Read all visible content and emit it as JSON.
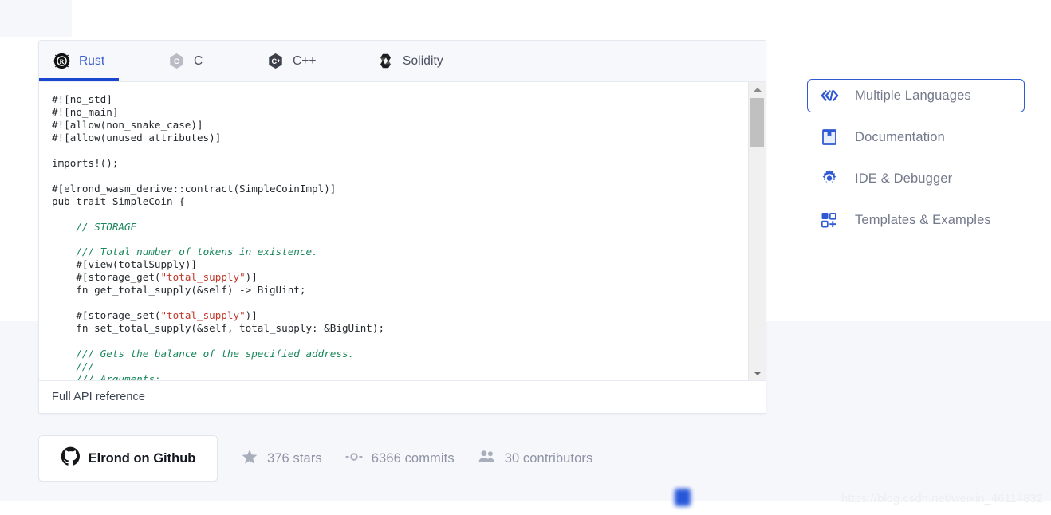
{
  "tabs": [
    {
      "label": "Rust",
      "icon": "rust-logo-icon",
      "active": true
    },
    {
      "label": "C",
      "icon": "c-logo-icon",
      "active": false
    },
    {
      "label": "C++",
      "icon": "cpp-logo-icon",
      "active": false
    },
    {
      "label": "Solidity",
      "icon": "solidity-logo-icon",
      "active": false
    }
  ],
  "code": {
    "language": "Rust",
    "lines": [
      "#![no_std]",
      "#![no_main]",
      "#![allow(non_snake_case)]",
      "#![allow(unused_attributes)]",
      "",
      "imports!();",
      "",
      "#[elrond_wasm_derive::contract(SimpleCoinImpl)]",
      "pub trait SimpleCoin {",
      "",
      "    // STORAGE",
      "",
      "    /// Total number of tokens in existence.",
      "    #[view(totalSupply)]",
      "    #[storage_get(\"total_supply\")]",
      "    fn get_total_supply(&self) -> BigUint;",
      "",
      "    #[storage_set(\"total_supply\")]",
      "    fn set_total_supply(&self, total_supply: &BigUint);",
      "",
      "    /// Gets the balance of the specified address.",
      "    ///",
      "    /// Arguments:"
    ]
  },
  "card_footer": {
    "api_reference_label": "Full API reference"
  },
  "scrollbar": {
    "up_arrow": "scroll-up-arrow-icon",
    "down_arrow": "scroll-down-arrow-icon",
    "thumb_position_percent": 5
  },
  "github": {
    "button_label": "Elrond on Github",
    "button_icon": "github-logo-icon",
    "stats": [
      {
        "icon": "star-icon",
        "text": "376 stars"
      },
      {
        "icon": "commit-icon",
        "text": "6366 commits"
      },
      {
        "icon": "contributors-icon",
        "text": "30 contributors"
      }
    ]
  },
  "sidebar": {
    "items": [
      {
        "label": "Multiple Languages",
        "icon": "code-brackets-icon",
        "active": true
      },
      {
        "label": "Documentation",
        "icon": "book-icon",
        "active": false
      },
      {
        "label": "IDE & Debugger",
        "icon": "gear-icon",
        "active": false
      },
      {
        "label": "Templates & Examples",
        "icon": "templates-add-icon",
        "active": false
      }
    ]
  },
  "watermark": {
    "text": "https://blog.csdn.net/weixin_46114832"
  },
  "colors": {
    "accent_blue": "#1b46d0",
    "tab_active_text": "#3a5ccc",
    "sidebar_border_active": "#2f5ad4",
    "code_comment_green": "#19855b",
    "code_string_red": "#c0392b",
    "page_band": "#f6f7fb"
  }
}
